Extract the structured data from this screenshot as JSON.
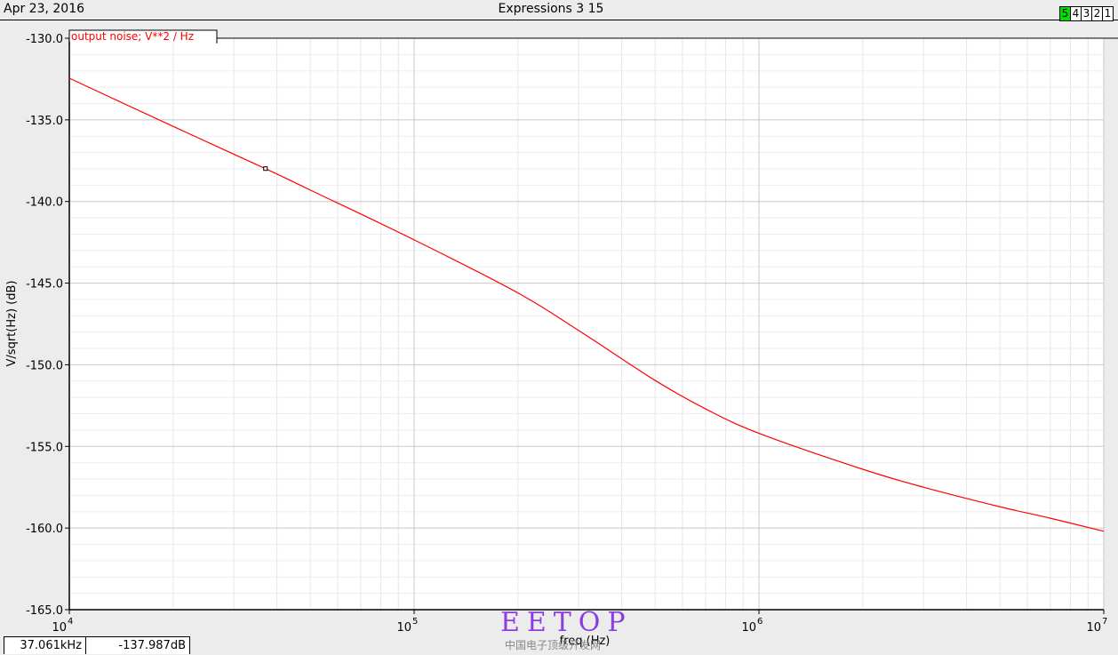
{
  "header": {
    "date": "Apr 23, 2016",
    "title": "Expressions 3 15",
    "tabs": [
      {
        "label": "5",
        "active": true
      },
      {
        "label": "4"
      },
      {
        "label": "3"
      },
      {
        "label": "2"
      },
      {
        "label": "1"
      }
    ]
  },
  "readout": {
    "x": "37.061kHz",
    "y": "-137.987dB"
  },
  "watermark": {
    "text": "EETOP",
    "subtext": "中国电子顶级开发网"
  },
  "chart_data": {
    "type": "line",
    "title": "",
    "xlabel": "freq (Hz)",
    "ylabel": "V/sqrt(Hz) (dB)",
    "xscale": "log",
    "xlim": [
      10000,
      10000000
    ],
    "ylim": [
      -165,
      -130
    ],
    "yticks": [
      -130,
      -135,
      -140,
      -145,
      -150,
      -155,
      -160,
      -165
    ],
    "ytick_labels": [
      "-130.0",
      "-135.0",
      "-140.0",
      "-145.0",
      "-150.0",
      "-155.0",
      "-160.0",
      "-165.0"
    ],
    "xticks": [
      {
        "base": "10",
        "exp": "4"
      },
      {
        "base": "10",
        "exp": "5"
      },
      {
        "base": "10",
        "exp": "6"
      },
      {
        "base": "10",
        "exp": "7"
      }
    ],
    "grid": true,
    "legend": {
      "placement": "top-left",
      "entries": [
        {
          "label": "output noise; V**2 / Hz",
          "color": "#ff0000"
        }
      ]
    },
    "series": [
      {
        "name": "output noise; V**2 / Hz",
        "color": "#ff0000",
        "x": [
          10000,
          20000,
          37061,
          50000,
          100000,
          200000,
          300000,
          500000,
          700000,
          1000000,
          2000000,
          3000000,
          5000000,
          7000000,
          10000000
        ],
        "y": [
          -132.45,
          -135.4,
          -137.99,
          -139.3,
          -142.35,
          -145.6,
          -147.9,
          -150.96,
          -152.7,
          -154.2,
          -156.4,
          -157.5,
          -158.7,
          -159.4,
          -160.2
        ]
      }
    ],
    "marker": {
      "x": 37061,
      "y": -137.987
    }
  }
}
